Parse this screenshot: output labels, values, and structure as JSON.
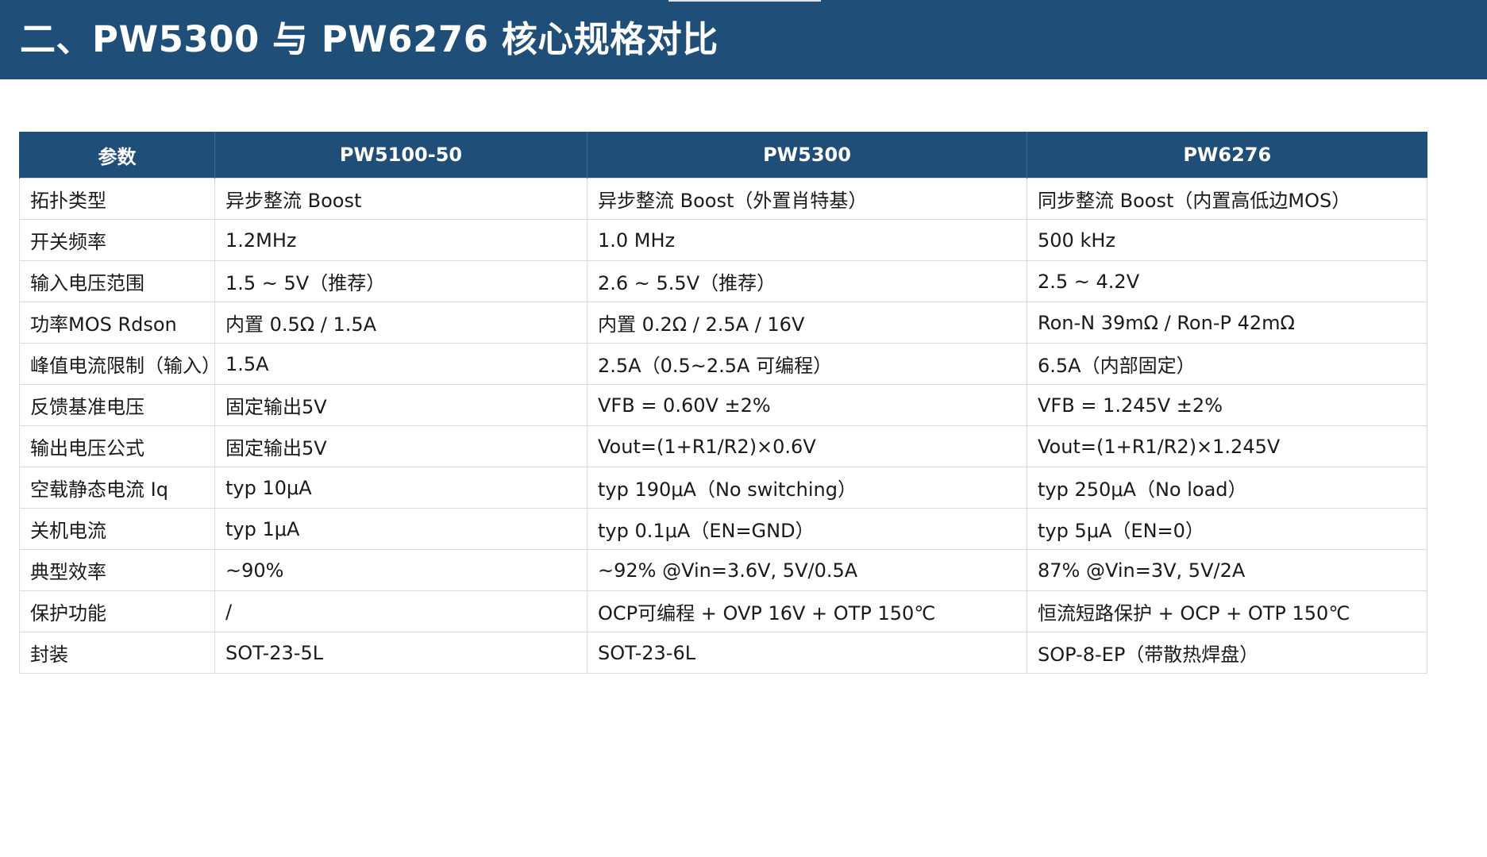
{
  "page": {
    "title": "二、PW5300 与 PW6276 核心规格对比"
  },
  "table": {
    "headers": [
      "参数",
      "PW5100-50",
      "PW5300",
      "PW6276"
    ],
    "rows": [
      [
        "拓扑类型",
        "异步整流 Boost",
        "异步整流 Boost（外置肖特基）",
        "同步整流 Boost（内置高低边MOS）"
      ],
      [
        "开关频率",
        "1.2MHz",
        "1.0 MHz",
        "500 kHz"
      ],
      [
        "输入电压范围",
        "1.5 ~ 5V（推荐）",
        "2.6 ~ 5.5V（推荐）",
        "2.5 ~ 4.2V"
      ],
      [
        "功率MOS Rdson",
        "内置 0.5Ω / 1.5A",
        "内置 0.2Ω / 2.5A / 16V",
        "Ron-N 39mΩ / Ron-P 42mΩ"
      ],
      [
        "峰值电流限制（输入）",
        "1.5A",
        "2.5A（0.5~2.5A 可编程）",
        "6.5A（内部固定）"
      ],
      [
        "反馈基准电压",
        "固定输出5V",
        "VFB = 0.60V ±2%",
        "VFB = 1.245V ±2%"
      ],
      [
        "输出电压公式",
        "固定输出5V",
        "Vout=(1+R1/R2)×0.6V",
        "Vout=(1+R1/R2)×1.245V"
      ],
      [
        "空载静态电流 Iq",
        "typ 10μA",
        "typ 190μA（No switching）",
        "typ 250μA（No load）"
      ],
      [
        "关机电流",
        "typ 1μA",
        "typ 0.1μA（EN=GND）",
        "typ 5μA（EN=0）"
      ],
      [
        "典型效率",
        "~90%",
        "~92% @Vin=3.6V, 5V/0.5A",
        "87% @Vin=3V, 5V/2A"
      ],
      [
        "保护功能",
        "/",
        "OCP可编程 + OVP 16V + OTP 150℃",
        "恒流短路保护 + OCP + OTP 150℃"
      ],
      [
        "封装",
        "SOT-23-5L",
        "SOT-23-6L",
        "SOP-8-EP（带散热焊盘）"
      ]
    ]
  },
  "colors": {
    "header_bg": "#1f4e79",
    "header_text": "#ffffff",
    "border": "#d4dce6"
  }
}
